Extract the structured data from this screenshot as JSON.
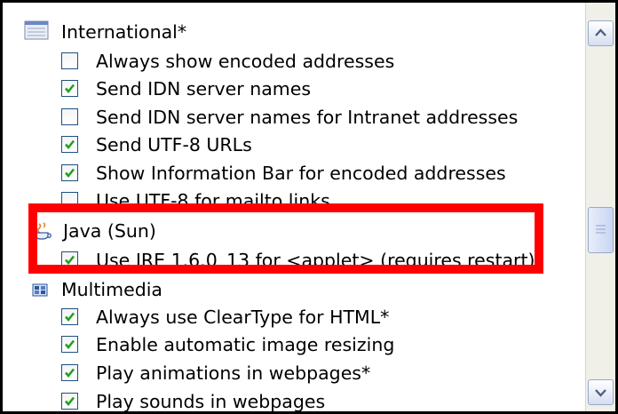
{
  "categories": {
    "international": {
      "label": "International*",
      "icon": "globe-settings-icon"
    },
    "java": {
      "label": "Java (Sun)",
      "icon": "java-cup-icon"
    },
    "multimedia": {
      "label": "Multimedia",
      "icon": "multimedia-icon"
    }
  },
  "items": {
    "always_show_encoded": {
      "label": "Always show encoded addresses",
      "checked": false
    },
    "send_idn_server_names": {
      "label": "Send IDN server names",
      "checked": true
    },
    "send_idn_intranet": {
      "label": "Send IDN server names for Intranet addresses",
      "checked": false
    },
    "send_utf8_urls": {
      "label": "Send UTF-8 URLs",
      "checked": true
    },
    "show_info_bar": {
      "label": "Show Information Bar for encoded addresses",
      "checked": true
    },
    "use_utf8_mailto": {
      "label": "Use UTF-8 for mailto links",
      "checked": false
    },
    "use_jre": {
      "label": "Use JRE 1.6.0_13 for <applet> (requires restart)",
      "checked": true
    },
    "cleartype": {
      "label": "Always use ClearType for HTML*",
      "checked": true
    },
    "auto_resize": {
      "label": "Enable automatic image resizing",
      "checked": true
    },
    "play_animations": {
      "label": "Play animations in webpages*",
      "checked": true
    },
    "play_sounds": {
      "label": "Play sounds in webpages",
      "checked": true
    }
  },
  "scrollbar": {
    "up_icon": "chevron-up-icon",
    "down_icon": "chevron-down-icon"
  },
  "colors": {
    "highlight": "#ff0000",
    "checkbox_border": "#1c5180",
    "checkmark": "#21a121"
  }
}
